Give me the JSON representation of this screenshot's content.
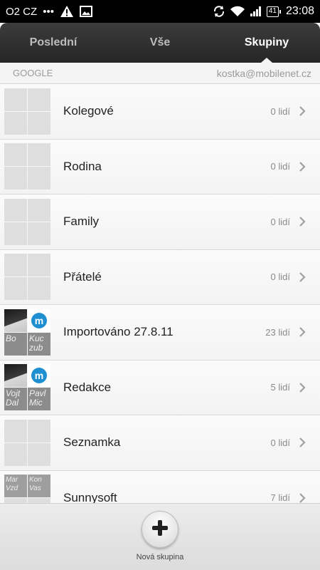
{
  "status_bar": {
    "carrier": "O2 CZ",
    "dots": "•••",
    "battery": "41",
    "time": "23:08"
  },
  "tabs": [
    {
      "label": "Poslední",
      "active": false
    },
    {
      "label": "Vše",
      "active": false
    },
    {
      "label": "Skupiny",
      "active": true
    }
  ],
  "account": {
    "type": "GOOGLE",
    "email": "kostka@mobilenet.cz"
  },
  "groups": [
    {
      "name": "Kolegové",
      "count": "0 lidí",
      "thumb": "empty"
    },
    {
      "name": "Rodina",
      "count": "0 lidí",
      "thumb": "empty"
    },
    {
      "name": "Family",
      "count": "0 lidí",
      "thumb": "empty"
    },
    {
      "name": "Přátelé",
      "count": "0 lidí",
      "thumb": "empty"
    },
    {
      "name": "Importováno 27.8.11",
      "count": "23 lidí",
      "thumb": "photos1"
    },
    {
      "name": "Redakce",
      "count": "5 lidí",
      "thumb": "photos2"
    },
    {
      "name": "Seznamka",
      "count": "0 lidí",
      "thumb": "empty"
    },
    {
      "name": "Sunnysoft",
      "count": "7 lidí",
      "thumb": "photos3"
    }
  ],
  "thumb_texts": {
    "photos1": [
      "",
      "m",
      "Bo",
      "Kuc zub"
    ],
    "photos2": [
      "",
      "m",
      "Vojt Dal",
      "Pavl Mic"
    ],
    "photos3": [
      "Mar Vzd",
      "Kon Vas",
      "",
      ""
    ]
  },
  "bottom": {
    "add_label": "Nová skupina"
  },
  "colors": {
    "tab_active": "#ffffff",
    "tab_inactive": "#bdbdbd",
    "logo_blue": "#1e8fd0"
  }
}
